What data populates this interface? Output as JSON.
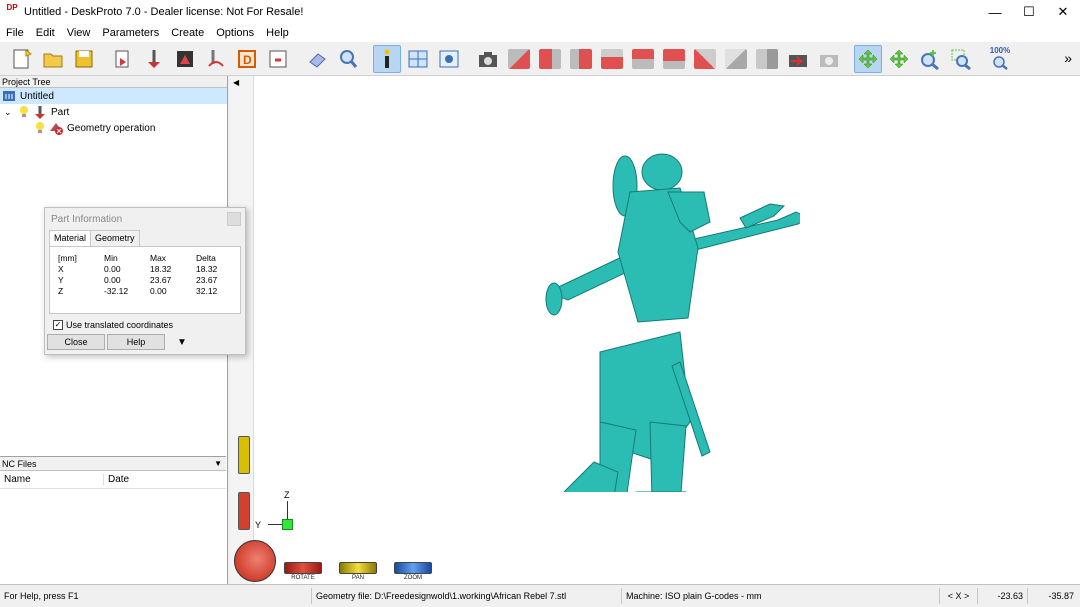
{
  "window": {
    "title": "Untitled - DeskProto 7.0 - Dealer license: Not For Resale!",
    "app_icon_text": "DP",
    "minimize": "—",
    "maximize": "☐",
    "close": "✕"
  },
  "menu": [
    "File",
    "Edit",
    "View",
    "Parameters",
    "Create",
    "Options",
    "Help"
  ],
  "toolbar": {
    "zoom_label": "100%",
    "overflow": "»",
    "colors": {
      "active_bg": "#b8d6f2",
      "cube_red": "#e05050",
      "cube_gray": "#a8a8a8",
      "arrow_green": "#5cc93a"
    }
  },
  "project_tree": {
    "header": "Project Tree",
    "items": [
      {
        "label": "Untitled",
        "level": 0,
        "selected": true
      },
      {
        "label": "Part",
        "level": 1
      },
      {
        "label": "Geometry operation",
        "level": 2
      }
    ]
  },
  "nc_files": {
    "header": "NC Files",
    "columns": [
      "Name",
      "Date"
    ]
  },
  "part_info": {
    "title": "Part Information",
    "tabs": [
      "Material",
      "Geometry"
    ],
    "active_tab": "Material",
    "headers": [
      "[mm]",
      "Min",
      "Max",
      "Delta"
    ],
    "rows": [
      [
        "X",
        "0.00",
        "18.32",
        "18.32"
      ],
      [
        "Y",
        "0.00",
        "23.67",
        "23.67"
      ],
      [
        "Z",
        "-32.12",
        "0.00",
        "32.12"
      ]
    ],
    "checkbox_label": "Use translated coordinates",
    "checkbox_checked": true,
    "close_button": "Close",
    "help_button": "Help"
  },
  "viewport": {
    "axis_z": "Z",
    "axis_y": "Y",
    "modes": [
      "ROTATE",
      "PAN",
      "ZOOM"
    ],
    "model_color": "#2bbdb4"
  },
  "status": {
    "help": "For Help, press F1",
    "geometry_file": "Geometry file: D:\\Freedesignwold\\1.working\\African Rebel 7.stl",
    "machine": "Machine: ISO plain G-codes - mm",
    "coord_label": "< X >",
    "coord_x": "-23.63",
    "coord_y": "-35.87"
  }
}
